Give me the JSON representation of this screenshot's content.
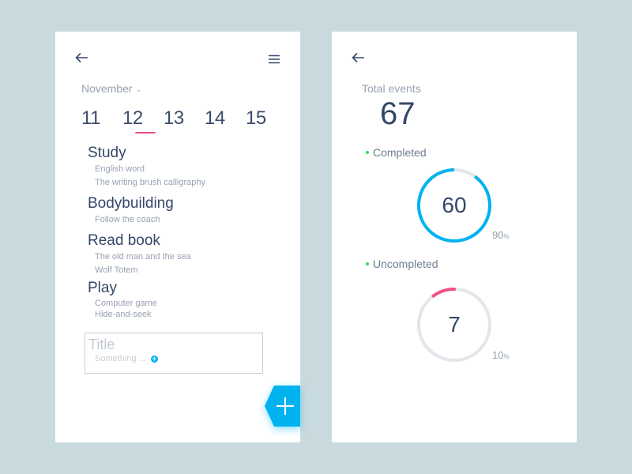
{
  "colors": {
    "background": "#c9dadf",
    "accent_blue": "#00b3ef",
    "accent_pink": "#f0508a",
    "track_gray": "#e3e6ea",
    "dot_green": "#2ee05e",
    "text_dark": "#34476a",
    "text_muted": "#97a2b1"
  },
  "calendar_screen": {
    "back_icon": "arrow-left-icon",
    "menu_icon": "hamburger-menu-icon",
    "month": "November",
    "month_chevron": "⌄",
    "days": [
      {
        "label": "11",
        "selected": false
      },
      {
        "label": "12",
        "selected": true
      },
      {
        "label": "13",
        "selected": false
      },
      {
        "label": "14",
        "selected": false
      },
      {
        "label": "15",
        "selected": false
      }
    ],
    "events": [
      {
        "title": "Study",
        "items": [
          "English word",
          "The writing brush calligraphy"
        ]
      },
      {
        "title": "Bodybuilding",
        "items": [
          "Follow the coach"
        ]
      },
      {
        "title": "Read book",
        "items": [
          "The old man and the sea",
          "Wolf Totem"
        ]
      },
      {
        "title": "Play",
        "items": [
          "Computer game",
          "Hide-and-seek"
        ]
      }
    ],
    "new_event": {
      "title_placeholder": "Title",
      "sub_placeholder": "Something ...",
      "add_icon": "plus-circle-icon",
      "add_glyph": "+"
    },
    "fab_icon": "plus-icon"
  },
  "stats_screen": {
    "back_icon": "arrow-left-icon",
    "total_label": "Total events",
    "total_value": "67",
    "completed": {
      "label": "Completed",
      "value": "60",
      "percent_number": "90",
      "percent_sign": "%",
      "fraction": 0.9
    },
    "uncompleted": {
      "label": "Uncompleted",
      "value": "7",
      "percent_number": "10",
      "percent_sign": "%",
      "fraction": 0.1
    }
  }
}
